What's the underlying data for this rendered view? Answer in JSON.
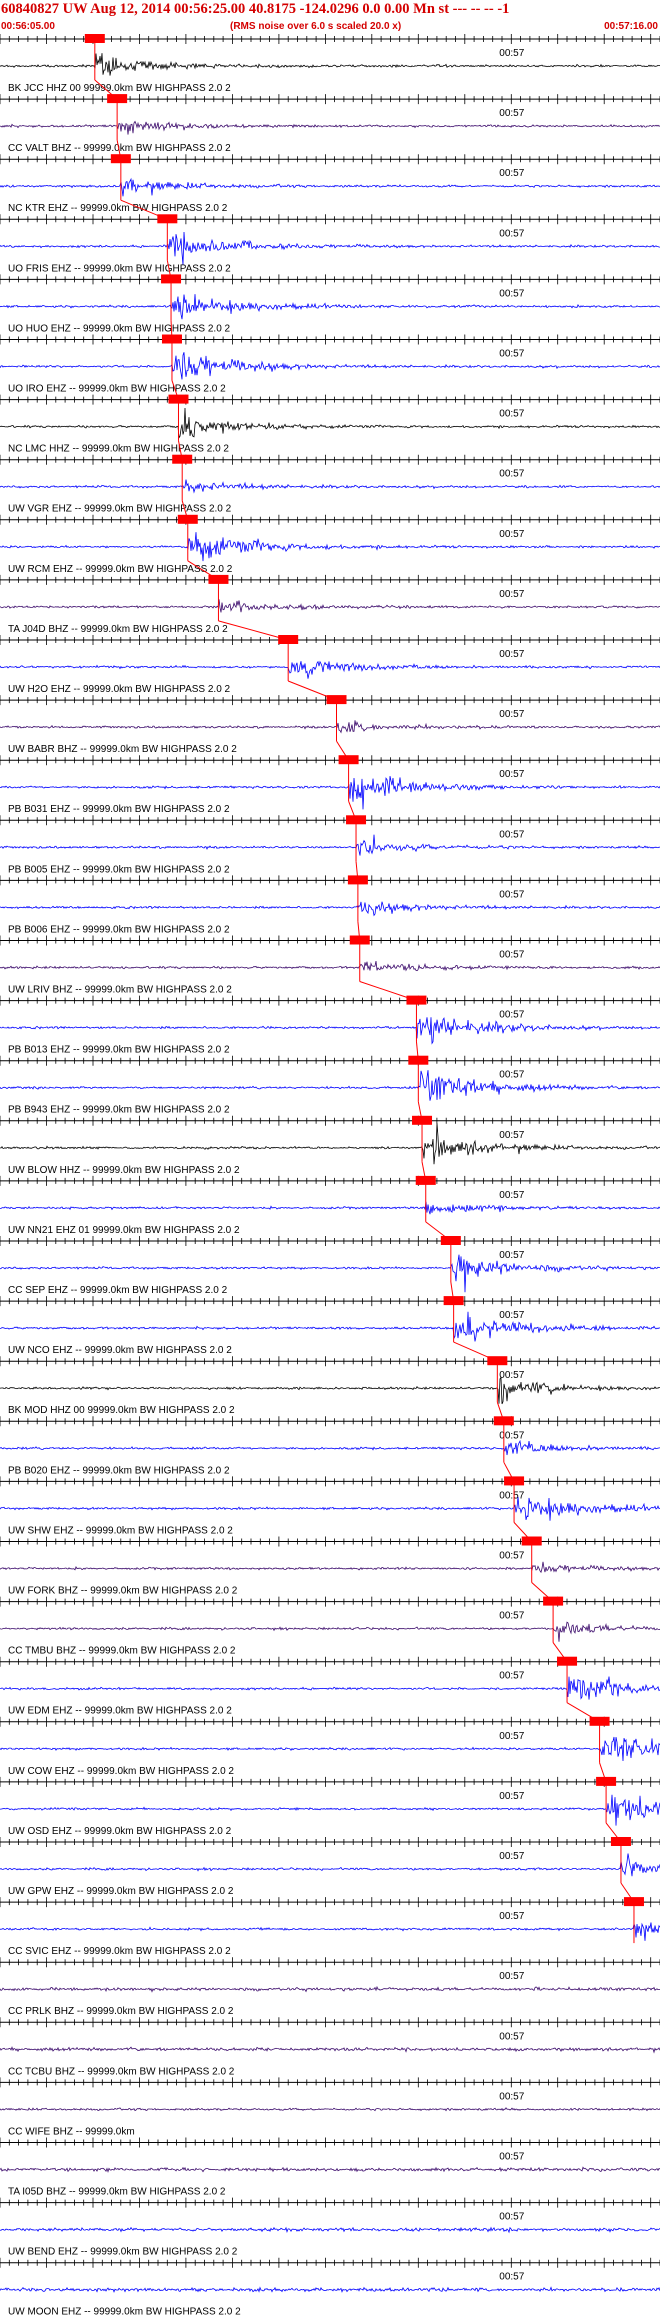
{
  "header": {
    "title": "60840827 UW Aug 12, 2014 00:56:25.00   40.8175 -124.0296  0.0 0.00 Mn st --- -- --  -1",
    "start_time": "00:56:05.00",
    "rms_note": "(RMS noise over 6.0 s scaled 20.0 x)",
    "end_time": "00:57:16.00"
  },
  "colors": {
    "header_text": "#d40000",
    "pick": "#ff0000",
    "trace_blue": "#0000ff",
    "trace_black": "#000000",
    "trace_purple": "#3b0a6b"
  },
  "chart_data": {
    "type": "seismogram",
    "x_axis": {
      "start": "00:56:05.00",
      "end": "00:57:16.00",
      "tick_label": "00:57"
    },
    "traces": [
      {
        "label": "BK JCC HHZ 00 99999.0km BW  HIGHPASS  2.0  2",
        "color": "black",
        "pick_time_s": 10.2,
        "amplitude": 1.0
      },
      {
        "label": "CC VALT BHZ -- 99999.0km BW  HIGHPASS  2.0  2",
        "color": "purple",
        "pick_time_s": 12.6,
        "amplitude": 0.7
      },
      {
        "label": "NC KTR EHZ -- 99999.0km BW  HIGHPASS  2.0  2",
        "color": "blue",
        "pick_time_s": 13.0,
        "amplitude": 0.6
      },
      {
        "label": "UO FRIS EHZ -- 99999.0km BW  HIGHPASS  2.0  2",
        "color": "blue",
        "pick_time_s": 18.0,
        "amplitude": 1.4
      },
      {
        "label": "UO HUO EHZ -- 99999.0km BW  HIGHPASS  2.0  2",
        "color": "blue",
        "pick_time_s": 18.4,
        "amplitude": 1.6
      },
      {
        "label": "UO IRO EHZ -- 99999.0km BW  HIGHPASS  2.0  2",
        "color": "blue",
        "pick_time_s": 18.5,
        "amplitude": 1.5
      },
      {
        "label": "NC LMC HHZ -- 99999.0km BW  HIGHPASS  2.0  2",
        "color": "black",
        "pick_time_s": 19.2,
        "amplitude": 1.0
      },
      {
        "label": "UW VGR EHZ -- 99999.0km BW  HIGHPASS  2.0  2",
        "color": "blue",
        "pick_time_s": 19.6,
        "amplitude": 0.5
      },
      {
        "label": "UW RCM EHZ -- 99999.0km BW  HIGHPASS  2.0  2",
        "color": "blue",
        "pick_time_s": 20.2,
        "amplitude": 1.6
      },
      {
        "label": "TA J04D BHZ -- 99999.0km BW  HIGHPASS  2.0  2",
        "color": "purple",
        "pick_time_s": 23.5,
        "amplitude": 0.5
      },
      {
        "label": "UW H2O EHZ -- 99999.0km BW  HIGHPASS  2.0  2",
        "color": "blue",
        "pick_time_s": 31.0,
        "amplitude": 0.9
      },
      {
        "label": "UW BABR BHZ -- 99999.0km BW  HIGHPASS  2.0  2",
        "color": "purple",
        "pick_time_s": 36.2,
        "amplitude": 0.5
      },
      {
        "label": "PB B031 EHZ -- 99999.0km BW  HIGHPASS  2.0  2",
        "color": "blue",
        "pick_time_s": 37.5,
        "amplitude": 1.5
      },
      {
        "label": "PB B005 EHZ -- 99999.0km BW  HIGHPASS  2.0  2",
        "color": "blue",
        "pick_time_s": 38.3,
        "amplitude": 0.6
      },
      {
        "label": "PB B006 EHZ -- 99999.0km BW  HIGHPASS  2.0  2",
        "color": "blue",
        "pick_time_s": 38.5,
        "amplitude": 0.6
      },
      {
        "label": "UW LRIV BHZ -- 99999.0km BW  HIGHPASS  2.0  2",
        "color": "purple",
        "pick_time_s": 38.7,
        "amplitude": 0.5
      },
      {
        "label": "PB B013 EHZ -- 99999.0km BW  HIGHPASS  2.0  2",
        "color": "blue",
        "pick_time_s": 44.8,
        "amplitude": 1.4
      },
      {
        "label": "PB B943 EHZ -- 99999.0km BW  HIGHPASS  2.0  2",
        "color": "blue",
        "pick_time_s": 45.0,
        "amplitude": 1.6
      },
      {
        "label": "UW BLOW HHZ -- 99999.0km BW  HIGHPASS  2.0  2",
        "color": "black",
        "pick_time_s": 45.4,
        "amplitude": 1.2
      },
      {
        "label": "UW NN21 EHZ 01 99999.0km BW  HIGHPASS  2.0  2",
        "color": "blue",
        "pick_time_s": 45.8,
        "amplitude": 0.6
      },
      {
        "label": "CC SEP EHZ -- 99999.0km BW  HIGHPASS  2.0  2",
        "color": "blue",
        "pick_time_s": 48.5,
        "amplitude": 1.3
      },
      {
        "label": "UW NCO EHZ -- 99999.0km BW  HIGHPASS  2.0  2",
        "color": "blue",
        "pick_time_s": 48.8,
        "amplitude": 1.3
      },
      {
        "label": "BK MOD HHZ 00 99999.0km BW  HIGHPASS  2.0  2",
        "color": "black",
        "pick_time_s": 53.5,
        "amplitude": 1.0
      },
      {
        "label": "PB B020 EHZ -- 99999.0km BW  HIGHPASS  2.0  2",
        "color": "blue",
        "pick_time_s": 54.2,
        "amplitude": 0.6
      },
      {
        "label": "UW SHW EHZ -- 99999.0km BW  HIGHPASS  2.0  2",
        "color": "blue",
        "pick_time_s": 55.3,
        "amplitude": 1.8
      },
      {
        "label": "UW FORK BHZ -- 99999.0km BW  HIGHPASS  2.0  2",
        "color": "purple",
        "pick_time_s": 57.2,
        "amplitude": 0.4
      },
      {
        "label": "CC TMBU BHZ -- 99999.0km BW  HIGHPASS  2.0  2",
        "color": "purple",
        "pick_time_s": 59.5,
        "amplitude": 0.6
      },
      {
        "label": "UW EDM EHZ -- 99999.0km BW  HIGHPASS  2.0  2",
        "color": "blue",
        "pick_time_s": 61.0,
        "amplitude": 1.3
      },
      {
        "label": "UW COW EHZ -- 99999.0km BW  HIGHPASS  2.0  2",
        "color": "blue",
        "pick_time_s": 64.5,
        "amplitude": 1.8
      },
      {
        "label": "UW OSD EHZ -- 99999.0km BW  HIGHPASS  2.0  2",
        "color": "blue",
        "pick_time_s": 65.2,
        "amplitude": 1.8
      },
      {
        "label": "UW GPW EHZ -- 99999.0km BW  HIGHPASS  2.0  2",
        "color": "blue",
        "pick_time_s": 66.8,
        "amplitude": 0.7
      },
      {
        "label": "CC SVIC EHZ -- 99999.0km BW  HIGHPASS  2.0  2",
        "color": "blue",
        "pick_time_s": 68.2,
        "amplitude": 0.7
      },
      {
        "label": "CC PRLK BHZ -- 99999.0km BW  HIGHPASS  2.0  2",
        "color": "purple",
        "pick_time_s": null,
        "amplitude": 0.5
      },
      {
        "label": "CC TCBU BHZ -- 99999.0km BW  HIGHPASS  2.0  2",
        "color": "purple",
        "pick_time_s": null,
        "amplitude": 0.5
      },
      {
        "label": "CC WIFE BHZ -- 99999.0km",
        "color": "purple",
        "pick_time_s": null,
        "amplitude": 0.0
      },
      {
        "label": "TA I05D BHZ -- 99999.0km BW  HIGHPASS  2.0  2",
        "color": "purple",
        "pick_time_s": null,
        "amplitude": 0.5
      },
      {
        "label": "UW BEND EHZ -- 99999.0km BW  HIGHPASS  2.0  2",
        "color": "blue",
        "pick_time_s": null,
        "amplitude": 0.6
      },
      {
        "label": "UW MOON EHZ -- 99999.0km BW  HIGHPASS  2.0  2",
        "color": "blue",
        "pick_time_s": null,
        "amplitude": 0.6
      }
    ]
  }
}
